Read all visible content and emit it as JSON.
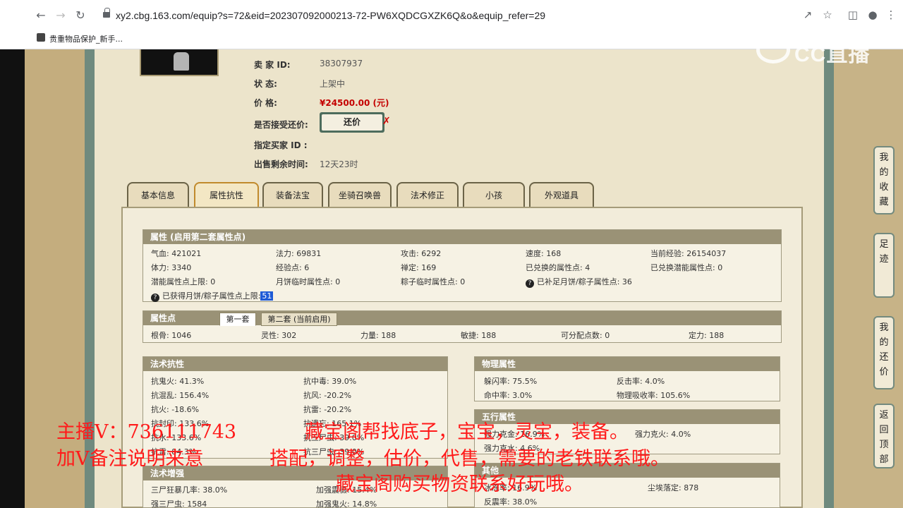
{
  "browser": {
    "url": "xy2.cbg.163.com/equip?s=72&eid=202307092000213-72-PW6XQDCGXZK6Q&o&equip_refer=29",
    "bookmark": "贵重物品保护_新手..."
  },
  "watermark": {
    "text": "CC直播"
  },
  "seller": {
    "id_label": "卖 家  ID:",
    "id_value": "38307937",
    "status_label": "状      态:",
    "status_value": "上架中",
    "price_label": "价      格:",
    "price_value": "¥24500.00 (元)",
    "haggle_label": "是否接受还价:",
    "haggle_button": "还价",
    "buyer_label": "指定买家 ID :",
    "remaining_label": "出售剩余时间:",
    "remaining_value": "12天23时"
  },
  "tabs": [
    "基本信息",
    "属性抗性",
    "装备法宝",
    "坐骑召唤兽",
    "法术修正",
    "小孩",
    "外观道具"
  ],
  "attr": {
    "title": "属性 (启用第二套属性点)",
    "rows": [
      [
        "气血: 421021",
        "法力: 69831",
        "攻击: 6292",
        "速度: 168",
        "当前经验: 26154037"
      ],
      [
        "体力: 3340",
        "经验点: 6",
        "禅定: 169",
        "已兑换的属性点: 4",
        "已兑换潜能属性点: 0"
      ],
      [
        "潜能属性点上限: 0",
        "月饼临时属性点: 0",
        "粽子临时属性点: 0",
        "已补足月饼/粽子属性点: 36",
        ""
      ]
    ],
    "note": "已获得月饼/粽子属性点上限:",
    "note_value": "51"
  },
  "points": {
    "title": "属性点",
    "tab1": "第一套",
    "tab2": "第二套 (当前启用)",
    "row": [
      "根骨: 1046",
      "灵性: 302",
      "力量: 188",
      "敏捷: 188",
      "可分配点数: 0",
      "定力: 188"
    ]
  },
  "resist": {
    "title": "法术抗性",
    "rows": [
      [
        "抗鬼火: 41.3%",
        "抗中毒: 39.0%"
      ],
      [
        "抗混乱: 156.4%",
        "抗风: -20.2%"
      ],
      [
        "抗火: -18.6%",
        "抗雷: -20.2%"
      ],
      [
        "抗封印: 133.6%",
        "抗遗忘: 165.1%"
      ],
      [
        "抗水: 133.6%",
        "抗三尸虫: 39.0%"
      ],
      [
        "抗雷: 84.3%",
        "抗三尸虫: 39.0%"
      ]
    ]
  },
  "enhance": {
    "title": "法术增强",
    "rows": [
      [
        "三尸狂暴几率: 38.0%",
        "加强震慑: 15.4%"
      ],
      [
        "强三尸虫: 1584",
        "加强鬼火: 14.8%"
      ]
    ]
  },
  "physical": {
    "title": "物理属性",
    "rows": [
      [
        "躲闪率: 75.5%",
        "反击率: 4.0%"
      ],
      [
        "命中率: 3.0%",
        "物理吸收率: 105.6%"
      ]
    ]
  },
  "elements": {
    "title": "五行属性",
    "rows": [
      [
        "强力克金: 16.9%",
        "强力克火: 4.0%"
      ],
      [
        "强力克水: 4.6%",
        ""
      ]
    ]
  },
  "other": {
    "title": "其他",
    "rows": [
      [
        "冰冻率: 16.9%",
        "尘埃落定: 878"
      ],
      [
        "反震率: 38.0%",
        ""
      ]
    ]
  },
  "float_nav": [
    "我的收藏",
    "足迹",
    "我的还价",
    "返回顶部"
  ],
  "overlay": {
    "line1a": "主播V：736111743",
    "line1b": "藏宝阁帮找底子，宝宝，灵宝，装备。",
    "line2a": "加V备注说明来意",
    "line2b": "搭配，调整，估价，代售，需要的老铁联系哦。",
    "line3": "藏宝阁购买物资联系好玩哦。"
  }
}
